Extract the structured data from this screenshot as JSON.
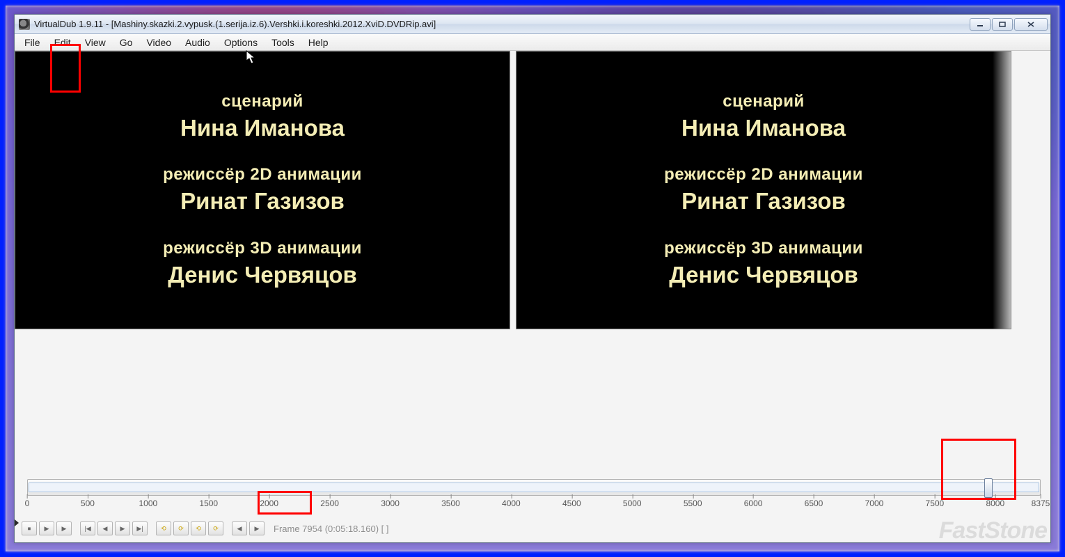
{
  "window": {
    "title": "VirtualDub 1.9.11 - [Mashiny.skazki.2.vypusk.(1.serija.iz.6).Vershki.i.koreshki.2012.XviD.DVDRip.avi]"
  },
  "menu": {
    "items": [
      "File",
      "Edit",
      "View",
      "Go",
      "Video",
      "Audio",
      "Options",
      "Tools",
      "Help"
    ]
  },
  "credits": {
    "blocks": [
      {
        "role": "сценарий",
        "name": "Нина Иманова"
      },
      {
        "role": "режиссёр 2D анимации",
        "name": "Ринат Газизов"
      },
      {
        "role": "режиссёр 3D анимации",
        "name": "Денис Червяцов"
      }
    ]
  },
  "timeline": {
    "ticks": [
      "0",
      "500",
      "1000",
      "1500",
      "2000",
      "2500",
      "3000",
      "3500",
      "4000",
      "4500",
      "5000",
      "5500",
      "6000",
      "6500",
      "7000",
      "7500",
      "8000",
      "8375"
    ],
    "thumb_position_pct": 94.9
  },
  "toolbar_buttons": [
    "⏹",
    "▶",
    "▶",
    "|◀",
    "◀",
    "▶",
    "▶|",
    "⟲",
    "⟳",
    "⟲",
    "⟳",
    "◀",
    "▶"
  ],
  "status": {
    "frame_text": "Frame 7954 (0:05:18.160)  [ ]"
  },
  "watermark": "FastStone"
}
